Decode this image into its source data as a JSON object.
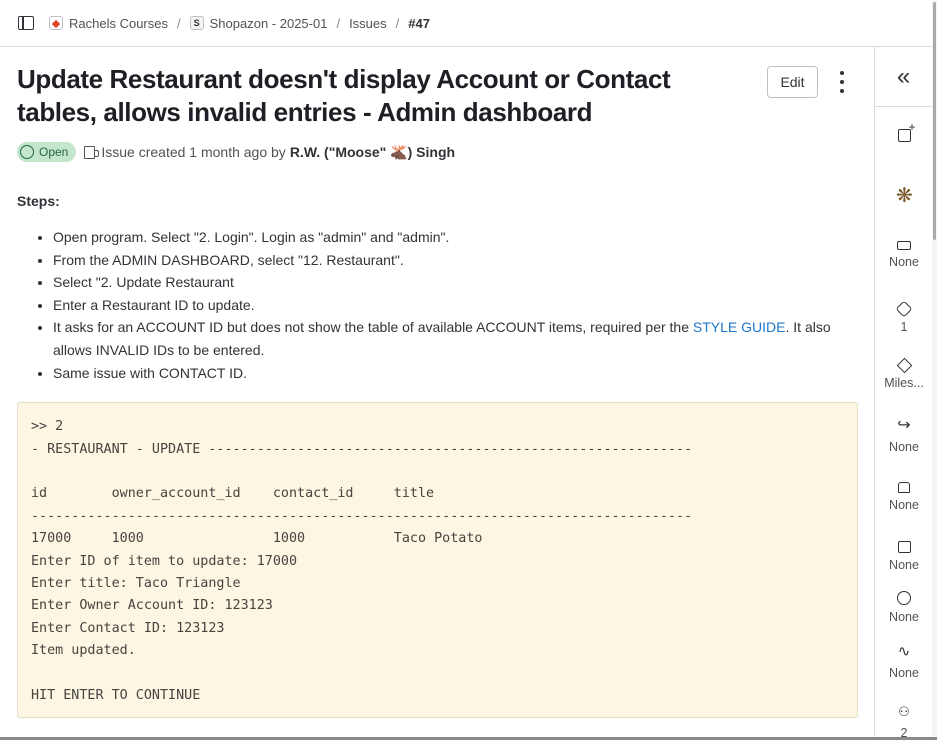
{
  "breadcrumb": {
    "items": [
      "Rachels Courses",
      "Shopazon - 2025-01",
      "Issues",
      "#47"
    ],
    "project_avatar_letter": "S"
  },
  "issue": {
    "title": "Update Restaurant doesn't display Account or Contact tables, allows invalid entries - Admin dashboard",
    "status": "Open",
    "created_text": "Issue created 1 month ago by",
    "author": "R.W. (\"Moose\" 🫎) Singh",
    "edit_label": "Edit",
    "steps_label": "Steps:",
    "steps": [
      "Open program. Select \"2. Login\". Login as \"admin\" and \"admin\".",
      "From the ADMIN DASHBOARD, select \"12. Restaurant\".",
      "Select \"2. Update Restaurant",
      "Enter a Restaurant ID to update."
    ],
    "step5_before": "It asks for an ACCOUNT ID but does not show the table of available ACCOUNT items, required per the ",
    "step5_link": "STYLE GUIDE",
    "step5_after": ". It also allows INVALID IDs to be entered.",
    "step6": "Same issue with CONTACT ID.",
    "code": ">> 2\n- RESTAURANT - UPDATE ------------------------------------------------------------\n\nid        owner_account_id    contact_id     title\n----------------------------------------------------------------------------------\n17000     1000                1000           Taco Potato\nEnter ID of item to update: 17000\nEnter title: Taco Triangle\nEnter Owner Account ID: 123123\nEnter Contact ID: 123123\nItem updated.\n\nHIT ENTER TO CONTINUE"
  },
  "sidebar": {
    "collapse_glyph": "«",
    "items": [
      {
        "name": "todo",
        "value": ""
      },
      {
        "name": "assignee",
        "value": ""
      },
      {
        "name": "epic",
        "value": "None"
      },
      {
        "name": "labels",
        "value": "1"
      },
      {
        "name": "milestone",
        "value": "Miles..."
      },
      {
        "name": "iteration",
        "value": "None"
      },
      {
        "name": "weight",
        "value": "None"
      },
      {
        "name": "due-date",
        "value": "None"
      },
      {
        "name": "time-tracking",
        "value": "None"
      },
      {
        "name": "health-status",
        "value": "None"
      },
      {
        "name": "participants",
        "value": "2"
      }
    ]
  },
  "colors": {
    "status_badge_bg": "#c3e6cd",
    "status_badge_text": "#24663b",
    "link": "#1f75cb",
    "code_bg": "#fdf6e3"
  }
}
